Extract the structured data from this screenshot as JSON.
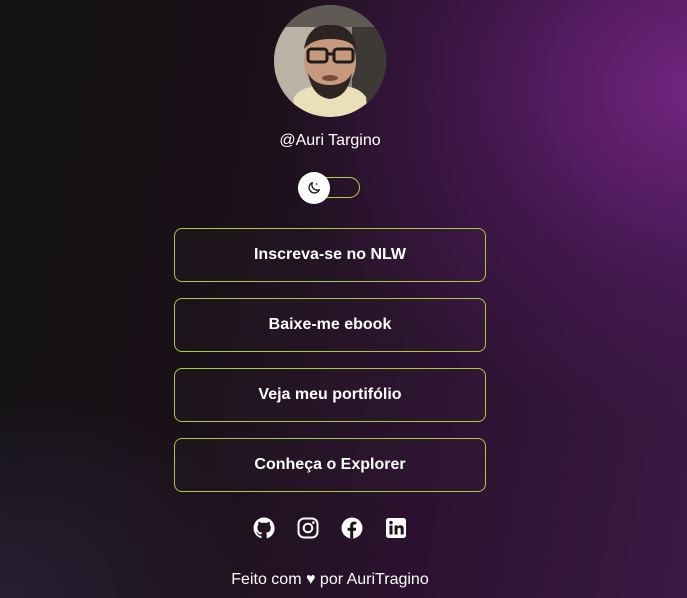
{
  "profile": {
    "username": "@Auri Targino",
    "avatar_icon": "profile-photo"
  },
  "theme_switch": {
    "icon": "moon-icon",
    "mode": "dark"
  },
  "links": [
    {
      "label": "Inscreva-se no NLW"
    },
    {
      "label": "Baixe-me ebook"
    },
    {
      "label": "Veja meu portifólio"
    },
    {
      "label": "Conheça o Explorer"
    }
  ],
  "socials": [
    {
      "icon": "github-icon"
    },
    {
      "icon": "instagram-icon"
    },
    {
      "icon": "facebook-icon"
    },
    {
      "icon": "linkedin-icon"
    }
  ],
  "footer": {
    "text": "Feito com ♥ por AuriTragino"
  },
  "colors": {
    "accent": "#a8cd3c",
    "text": "#ffffff",
    "background": "#121212",
    "gradient_purple": "#7d288c"
  }
}
